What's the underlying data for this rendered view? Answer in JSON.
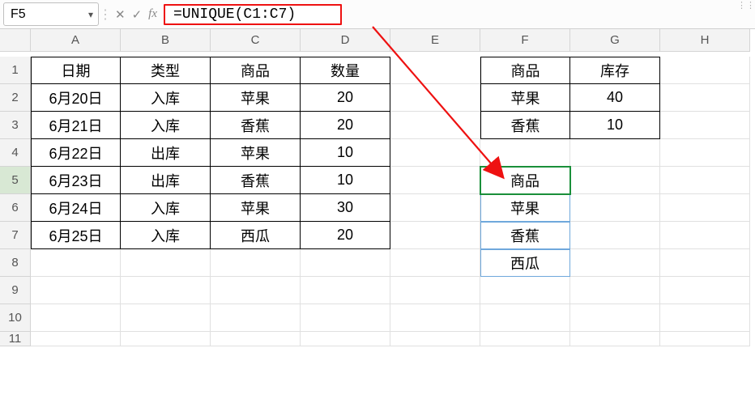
{
  "name_box": "F5",
  "formula": "=UNIQUE(C1:C7)",
  "col_headers": [
    "A",
    "B",
    "C",
    "D",
    "E",
    "F",
    "G",
    "H"
  ],
  "row_headers": [
    "1",
    "2",
    "3",
    "4",
    "5",
    "6",
    "7",
    "8",
    "9",
    "10",
    "11"
  ],
  "active_col": "F",
  "active_row": "5",
  "tableA": {
    "headers": [
      "日期",
      "类型",
      "商品",
      "数量"
    ],
    "rows": [
      [
        "6月20日",
        "入库",
        "苹果",
        "20"
      ],
      [
        "6月21日",
        "入库",
        "香蕉",
        "20"
      ],
      [
        "6月22日",
        "出库",
        "苹果",
        "10"
      ],
      [
        "6月23日",
        "出库",
        "香蕉",
        "10"
      ],
      [
        "6月24日",
        "入库",
        "苹果",
        "30"
      ],
      [
        "6月25日",
        "入库",
        "西瓜",
        "20"
      ]
    ]
  },
  "tableFG": {
    "headers": [
      "商品",
      "库存"
    ],
    "rows": [
      [
        "苹果",
        "40"
      ],
      [
        "香蕉",
        "10"
      ]
    ]
  },
  "spillF": [
    "商品",
    "苹果",
    "香蕉",
    "西瓜"
  ],
  "fx_label": "fx",
  "expand_glyph": "⋮⋮"
}
